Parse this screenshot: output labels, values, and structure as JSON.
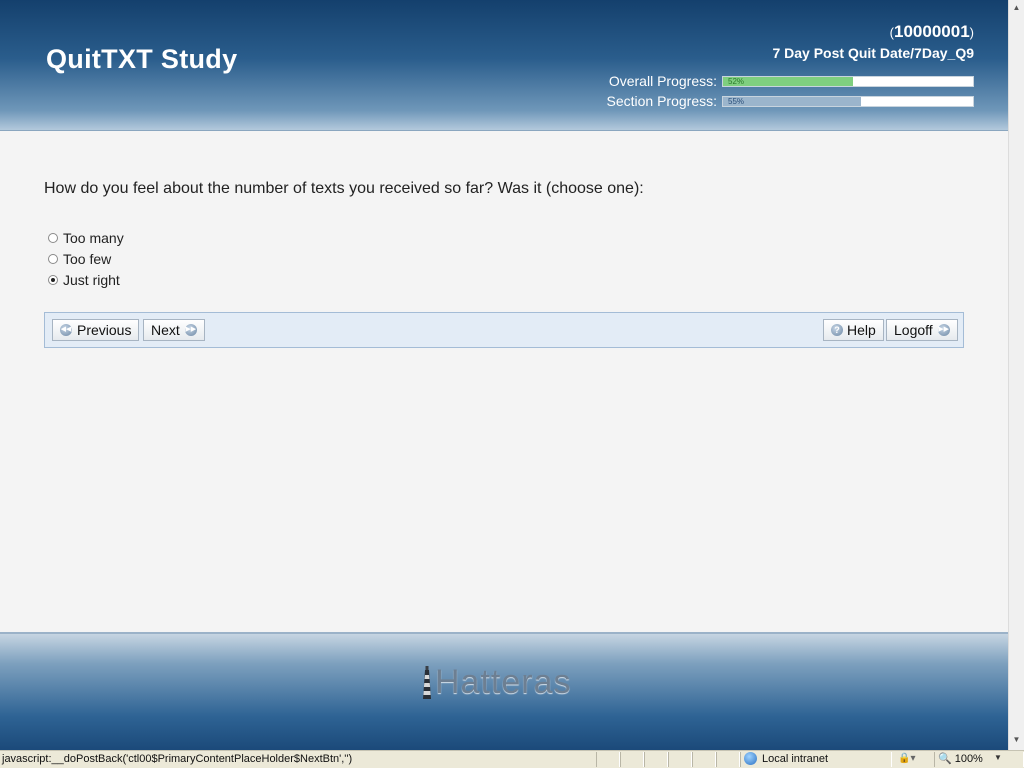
{
  "header": {
    "study_title": "QuitTXT Study",
    "participant_id": "10000001",
    "section_name": "7 Day Post Quit Date/7Day_Q9",
    "overall_progress": {
      "label": "Overall Progress:",
      "percent_text": "52%",
      "value": 0.52,
      "color": "#7fcf7f"
    },
    "section_progress": {
      "label": "Section Progress:",
      "percent_text": "55%",
      "value": 0.55,
      "color": "#9bb5cc"
    }
  },
  "question": {
    "text": "How do you feel about the number of texts you received so far? Was it (choose one):",
    "options": [
      {
        "label": "Too many",
        "selected": false
      },
      {
        "label": "Too few",
        "selected": false
      },
      {
        "label": "Just right",
        "selected": true
      }
    ]
  },
  "nav": {
    "previous": "Previous",
    "next": "Next",
    "help": "Help",
    "logoff": "Logoff"
  },
  "footer": {
    "logo_text": "Hatteras"
  },
  "status_bar": {
    "text": "javascript:__doPostBack('ctl00$PrimaryContentPlaceHolder$NextBtn','')",
    "zone": "Local intranet",
    "zoom": "100%"
  }
}
